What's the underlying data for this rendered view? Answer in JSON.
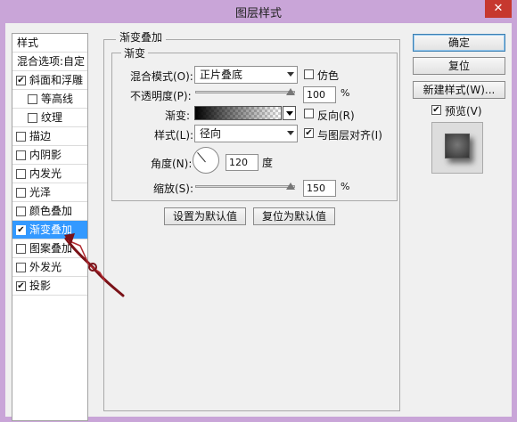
{
  "window": {
    "title": "图层样式",
    "close_glyph": "✕"
  },
  "style_list": {
    "header": "样式",
    "blend_options": "混合选项:自定",
    "items": [
      {
        "label": "斜面和浮雕",
        "checked": true,
        "selected": false,
        "indent": false
      },
      {
        "label": "等高线",
        "checked": false,
        "selected": false,
        "indent": true
      },
      {
        "label": "纹理",
        "checked": false,
        "selected": false,
        "indent": true
      },
      {
        "label": "描边",
        "checked": false,
        "selected": false,
        "indent": false
      },
      {
        "label": "内阴影",
        "checked": false,
        "selected": false,
        "indent": false
      },
      {
        "label": "内发光",
        "checked": false,
        "selected": false,
        "indent": false
      },
      {
        "label": "光泽",
        "checked": false,
        "selected": false,
        "indent": false
      },
      {
        "label": "颜色叠加",
        "checked": false,
        "selected": false,
        "indent": false
      },
      {
        "label": "渐变叠加",
        "checked": true,
        "selected": true,
        "indent": false
      },
      {
        "label": "图案叠加",
        "checked": false,
        "selected": false,
        "indent": false
      },
      {
        "label": "外发光",
        "checked": false,
        "selected": false,
        "indent": false
      },
      {
        "label": "投影",
        "checked": true,
        "selected": false,
        "indent": false
      }
    ]
  },
  "panel": {
    "title": "渐变叠加",
    "section": "渐变",
    "blend_mode_label": "混合模式(O):",
    "blend_mode_value": "正片叠底",
    "dither_label": "仿色",
    "opacity_label": "不透明度(P):",
    "opacity_value": "100",
    "opacity_unit": "%",
    "gradient_label": "渐变:",
    "reverse_label": "反向(R)",
    "style_label": "样式(L):",
    "style_value": "径向",
    "align_label": "与图层对齐(I)",
    "angle_label": "角度(N):",
    "angle_value": "120",
    "angle_unit": "度",
    "scale_label": "缩放(S):",
    "scale_value": "150",
    "scale_unit": "%",
    "make_default": "设置为默认值",
    "reset_default": "复位为默认值"
  },
  "right": {
    "ok": "确定",
    "reset": "复位",
    "new_style": "新建样式(W)...",
    "preview_label": "预览(V)"
  },
  "check_glyph": "✔"
}
